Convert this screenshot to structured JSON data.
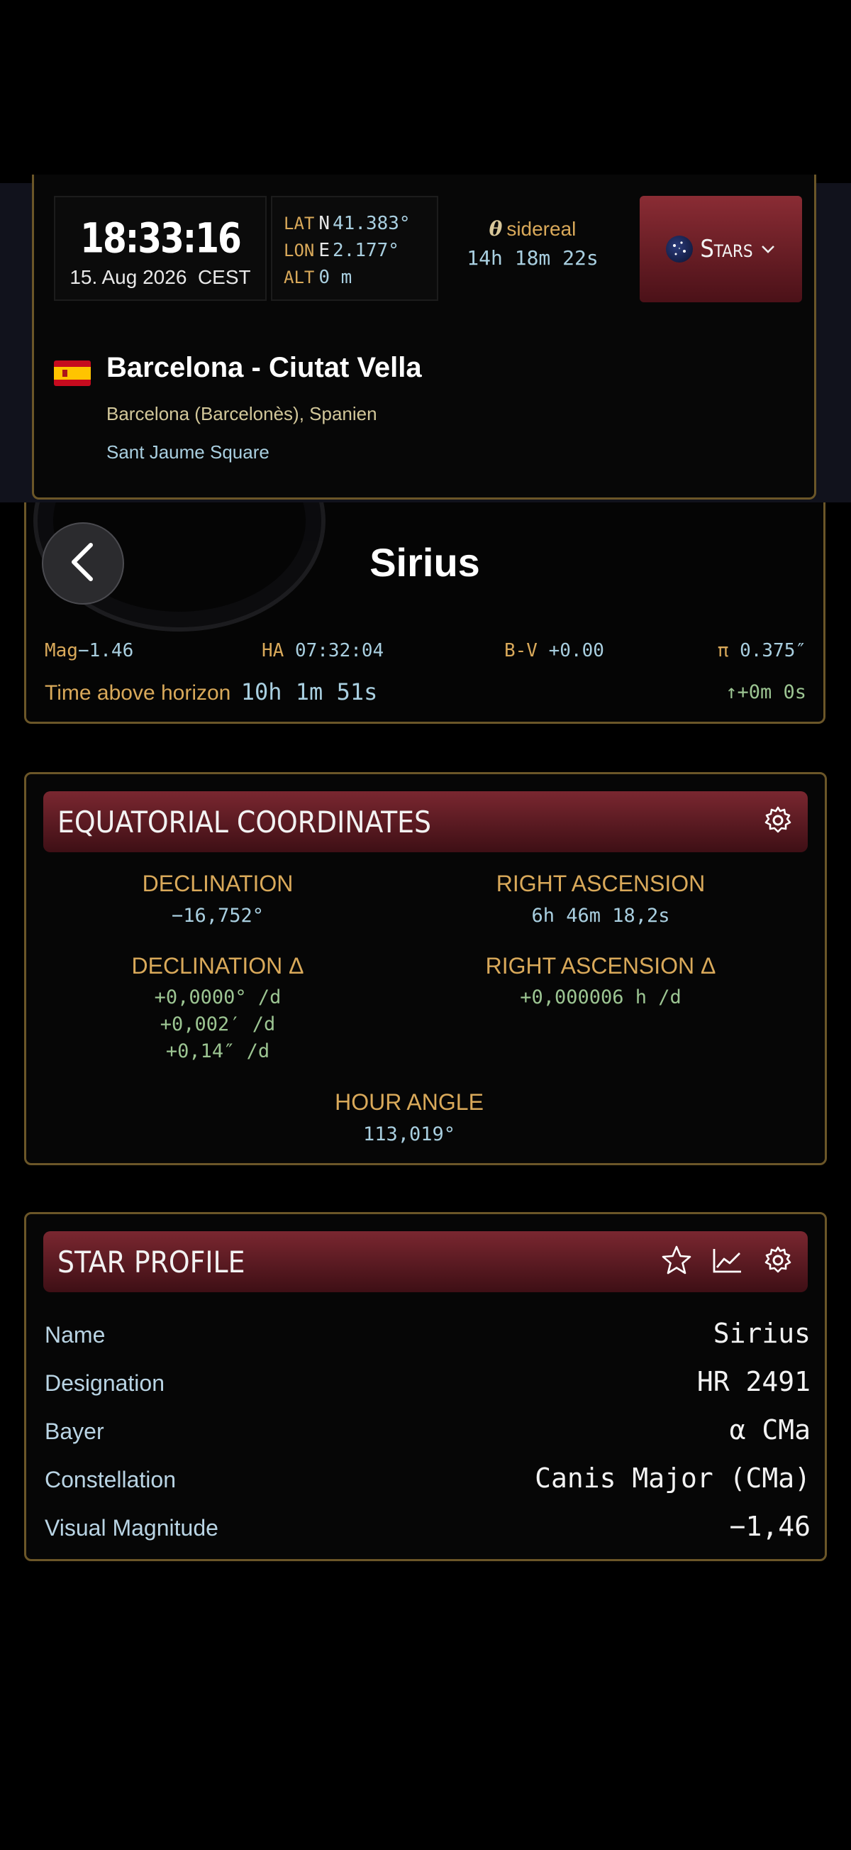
{
  "header": {
    "time": "18:33:16",
    "date": "15. Aug 2026",
    "timezone": "CEST",
    "lat": {
      "label": "LAT",
      "dir": "N",
      "value": "41.383°"
    },
    "lon": {
      "label": "LON",
      "dir": "E",
      "value": "2.177°"
    },
    "alt": {
      "label": "ALT",
      "value": "0 m"
    },
    "sidereal_symbol": "θ",
    "sidereal_label": "sidereal",
    "sidereal_value": "14h 18m 22s",
    "catalog_button": "Stars",
    "location": {
      "flag": "flag-spain-icon",
      "title": "Barcelona - Ciutat Vella",
      "region": "Barcelona (Barcelonès), Spanien",
      "place": "Sant Jaume Square"
    }
  },
  "star": {
    "name": "Sirius",
    "mag_label": "Mag",
    "mag": "−1.46",
    "ha_label": "HA",
    "ha": "07:32:04",
    "bv_label": "B-V",
    "bv": "+0.00",
    "parallax_label": "π",
    "parallax": "0.375″",
    "time_above_label": "Time above horizon",
    "time_above": "10h 1m 51s",
    "rise_arrow": "↑",
    "rise_delta": "+0m 0s"
  },
  "equatorial": {
    "title": "EQUATORIAL COORDINATES",
    "dec_label": "DECLINATION",
    "dec": "−16,752°",
    "ra_label": "RIGHT ASCENSION",
    "ra": "6h 46m 18,2s",
    "dec_delta_label": "DECLINATION Δ",
    "dec_delta": [
      "+0,0000° /d",
      "+0,002′ /d",
      "+0,14″ /d"
    ],
    "ra_delta_label": "RIGHT ASCENSION Δ",
    "ra_delta": "+0,000006 h /d",
    "ha_label": "HOUR ANGLE",
    "ha": "113,019°"
  },
  "profile": {
    "title": "STAR PROFILE",
    "rows": [
      {
        "key": "Name",
        "value": "Sirius"
      },
      {
        "key": "Designation",
        "value": "HR 2491"
      },
      {
        "key": "Bayer",
        "value": "α CMa"
      },
      {
        "key": "Constellation",
        "value": "Canis Major (CMa)"
      },
      {
        "key": "Visual Magnitude",
        "value": "−1,46"
      }
    ]
  },
  "colors": {
    "accent_gold": "#d9a95a",
    "value_cyan": "#a9cfe0",
    "delta_green": "#9cc592",
    "header_red": "#7a2730",
    "border": "#6b5628"
  }
}
